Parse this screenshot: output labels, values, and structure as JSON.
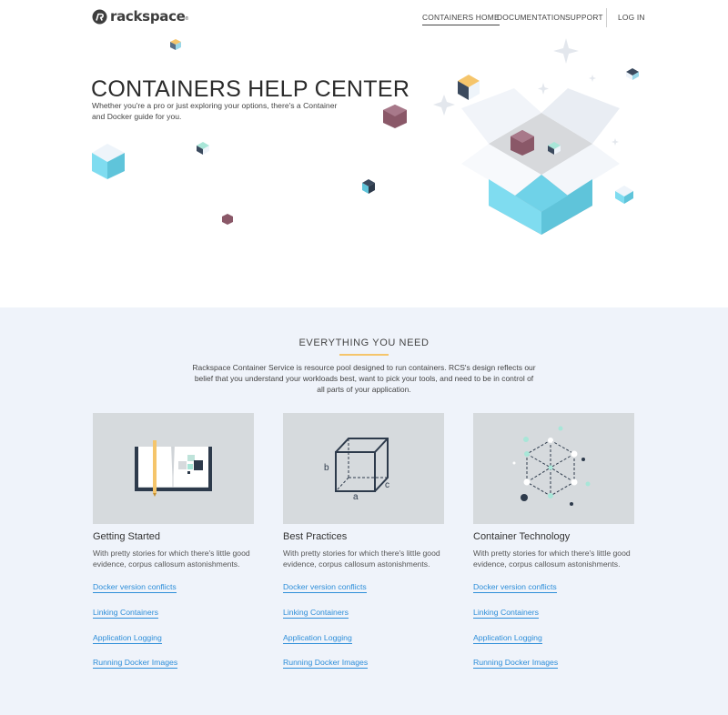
{
  "brand": {
    "name": "rackspace",
    "registered": "®"
  },
  "nav": {
    "containers_home": "CONTAINERS HOME",
    "documentation": "DOCUMENTATION",
    "support": "SUPPORT",
    "login": "LOG IN"
  },
  "hero": {
    "title": "CONTAINERS HELP CENTER",
    "subtitle": "Whether you're a pro or just exploring your options, there's a Container and Docker guide for you."
  },
  "features": {
    "title": "EVERYTHING YOU NEED",
    "description": "Rackspace Container Service is resource pool designed to run containers. RCS's design reflects our belief that you understand your workloads best, want to pick your tools, and need to be in control of all parts of your application.",
    "cube_labels": {
      "a": "a",
      "b": "b",
      "c": "c"
    },
    "cards": [
      {
        "title": "Getting Started",
        "description": "With pretty stories for which there's little good evidence, corpus callosum astonishments.",
        "links": [
          "Docker version conflicts",
          "Linking Containers",
          "Application Logging",
          "Running Docker Images"
        ]
      },
      {
        "title": "Best Practices",
        "description": "With pretty stories for which there's little good evidence, corpus callosum astonishments.",
        "links": [
          "Docker version conflicts",
          "Linking Containers",
          "Application Logging",
          "Running Docker Images"
        ]
      },
      {
        "title": "Container Technology",
        "description": "With pretty stories for which there's little good evidence, corpus callosum astonishments.",
        "links": [
          "Docker version conflicts",
          "Linking Containers",
          "Application Logging",
          "Running Docker Images"
        ]
      }
    ]
  },
  "icons": [
    "rackspace-logo-icon",
    "open-box-icon",
    "open-book-icon",
    "cube-diagram-icon",
    "network-cube-icon"
  ],
  "colors": {
    "link": "#2d8ed9",
    "accent_rule": "#f5c56b",
    "section_bg": "#eff3fa",
    "card_image_bg": "#d6dadd",
    "box_cyan": "#7fdcf0",
    "cube_mauve": "#8a5868"
  }
}
